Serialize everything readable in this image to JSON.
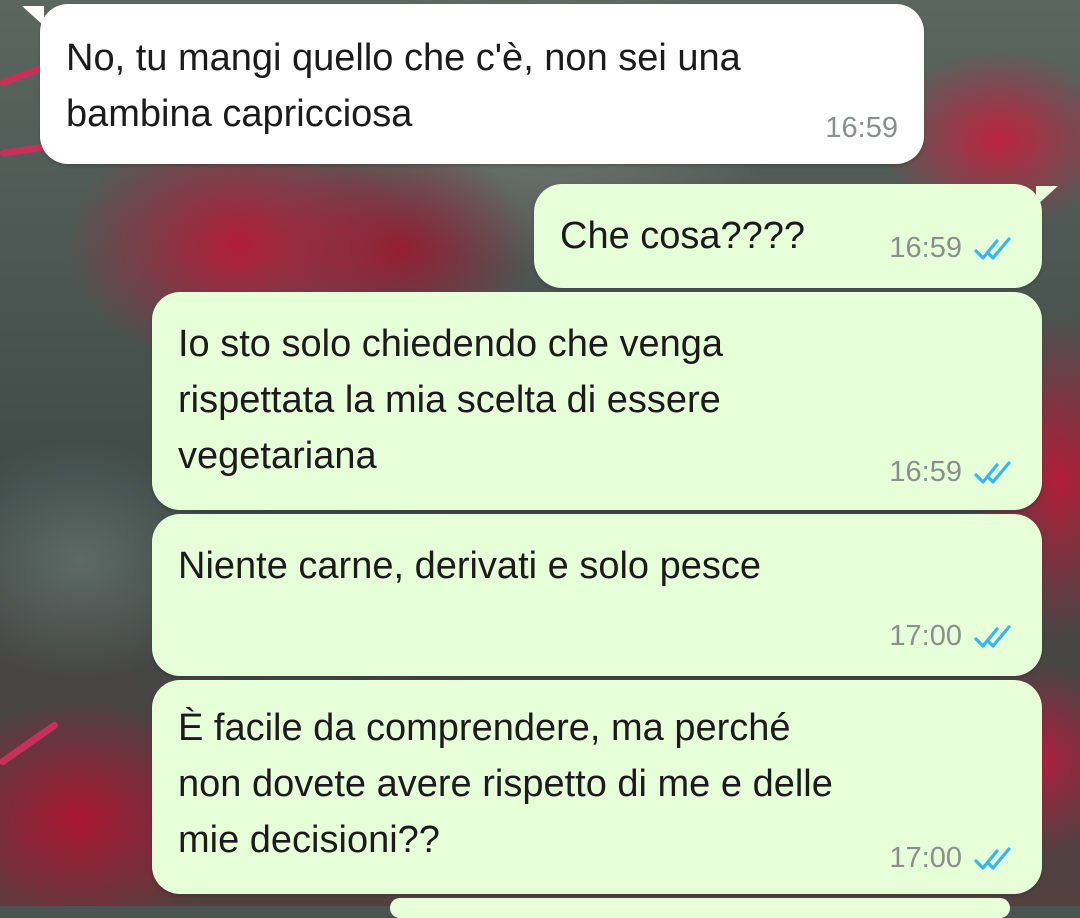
{
  "messages": [
    {
      "direction": "incoming",
      "text": "No, tu mangi quello che c'è, non sei una\nbambina capricciosa",
      "time": "16:59"
    },
    {
      "direction": "outgoing",
      "text": "Che cosa????",
      "time": "16:59",
      "status": "read"
    },
    {
      "direction": "outgoing",
      "text": "Io sto solo chiedendo che venga\nrispettata la mia scelta di essere\nvegetariana",
      "time": "16:59",
      "status": "read"
    },
    {
      "direction": "outgoing",
      "text": "Niente carne, derivati e solo pesce",
      "time": "17:00",
      "status": "read"
    },
    {
      "direction": "outgoing",
      "text": "È facile da comprendere, ma perché\nnon dovete avere rispetto di me e delle\nmie decisioni??",
      "time": "17:00",
      "status": "read"
    }
  ],
  "icons": {
    "read_receipt": "double-check-icon"
  },
  "colors": {
    "incoming_bubble": "#ffffff",
    "outgoing_bubble": "#e6ffd9",
    "text": "#1b1b1b",
    "timestamp": "#8a8f8c",
    "read_ticks": "#34b7f1"
  }
}
